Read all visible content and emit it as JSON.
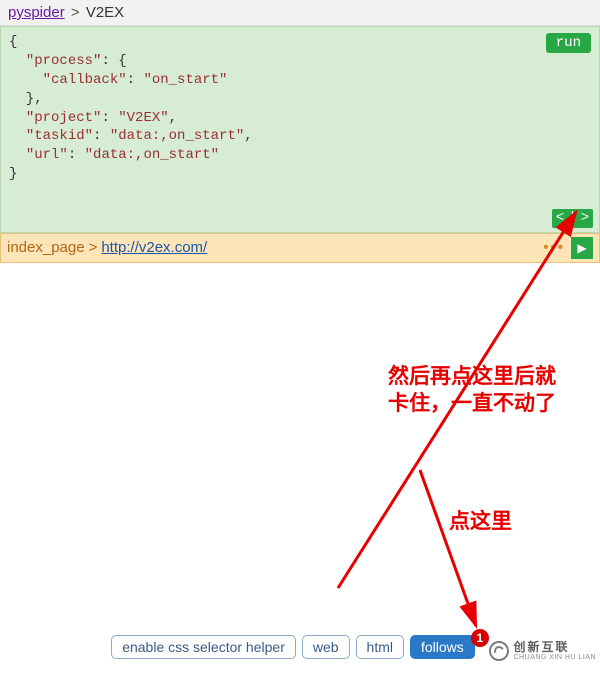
{
  "breadcrumb": {
    "project_label": "pyspider",
    "sep": ">",
    "spider_name": "V2EX"
  },
  "code": {
    "process_key": "\"process\"",
    "callback_key": "\"callback\"",
    "callback_val": "\"on_start\"",
    "project_key": "\"project\"",
    "project_val": "\"V2EX\"",
    "taskid_key": "\"taskid\"",
    "taskid_val": "\"data:,on_start\"",
    "url_key": "\"url\"",
    "url_val": "\"data:,on_start\""
  },
  "buttons": {
    "run": "run",
    "nav_prev": "<",
    "nav_sep": "|",
    "nav_next": ">"
  },
  "follow_bar": {
    "callback": "index_page",
    "sep": ">",
    "url": "http://v2ex.com/",
    "ellipsis": "•••",
    "play": "▶"
  },
  "annotations": {
    "a1_line1": "然后再点这里后就",
    "a1_line2": "卡住，一直不动了",
    "a2": "点这里"
  },
  "bottom": {
    "css_helper": "enable css selector helper",
    "web": "web",
    "html": "html",
    "follows": "follows",
    "badge": "1"
  },
  "watermark": {
    "cn": "创新互联",
    "en": "CHUANG XIN HU LIAN"
  }
}
